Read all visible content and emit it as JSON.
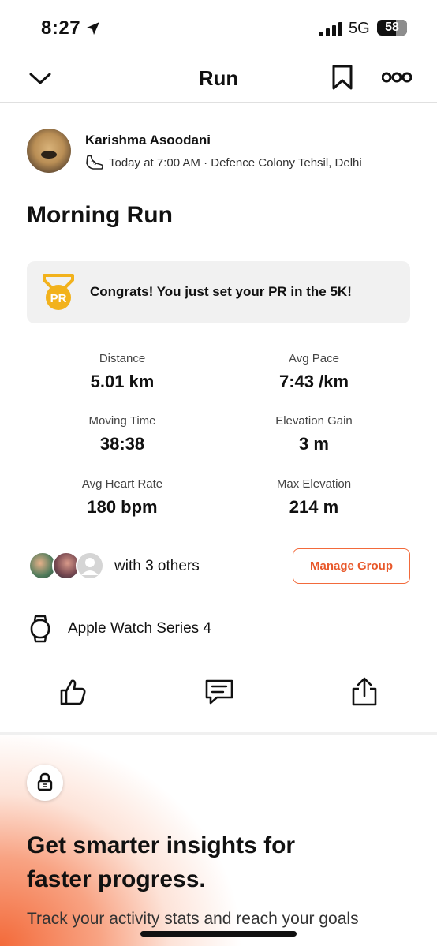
{
  "status_bar": {
    "time": "8:27",
    "network": "5G",
    "battery": "58"
  },
  "nav": {
    "title": "Run",
    "icons": {
      "back": "chevron-down-icon",
      "bookmark": "bookmark-icon",
      "more": "more-icon"
    }
  },
  "activity": {
    "athlete_name": "Karishma Asoodani",
    "meta": "Today at 7:00 AM · Defence Colony Tehsil, Delhi",
    "title": "Morning Run"
  },
  "pr_card": {
    "badge": "PR",
    "message": "Congrats! You just set your PR in the 5K!"
  },
  "stats": [
    {
      "label": "Distance",
      "value": "5.01 km"
    },
    {
      "label": "Avg Pace",
      "value": "7:43 /km"
    },
    {
      "label": "Moving Time",
      "value": "38:38"
    },
    {
      "label": "Elevation Gain",
      "value": "3 m"
    },
    {
      "label": "Avg Heart Rate",
      "value": "180 bpm"
    },
    {
      "label": "Max Elevation",
      "value": "214 m"
    }
  ],
  "group": {
    "text": "with 3 others",
    "button": "Manage Group"
  },
  "device": {
    "name": "Apple Watch Series 4"
  },
  "actions": [
    "thumbs-up-icon",
    "comment-icon",
    "share-icon"
  ],
  "upsell": {
    "title": "Get smarter insights for faster progress.",
    "subtitle": "Track your activity stats and reach your goals"
  },
  "colors": {
    "accent": "#f26a3b",
    "medal": "#f2b21c"
  }
}
